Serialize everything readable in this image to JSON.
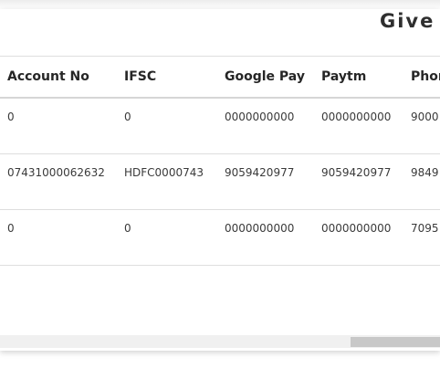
{
  "page": {
    "heading": "Give"
  },
  "table": {
    "columns": [
      "Account No",
      "IFSC",
      "Google Pay",
      "Paytm",
      "Phon"
    ],
    "rows": [
      [
        "0",
        "0",
        "0000000000",
        "0000000000",
        "9000"
      ],
      [
        "07431000062632",
        "HDFC0000743",
        "9059420977",
        "9059420977",
        "9849"
      ],
      [
        "0",
        "0",
        "0000000000",
        "0000000000",
        "7095"
      ]
    ]
  }
}
